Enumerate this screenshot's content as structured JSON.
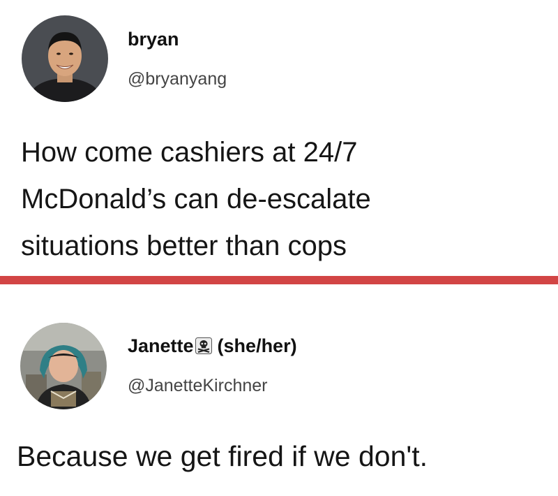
{
  "tweet_1": {
    "display_name": "bryan",
    "handle": "@bryanyang",
    "text_lines": [
      "How come cashiers at 24/7",
      "McDonald’s can de-escalate",
      "situations better than cops"
    ]
  },
  "tweet_2": {
    "display_name": "Janette",
    "badge_icon": "skull-crossbones-icon",
    "pronouns": "(she/her)",
    "handle": "@JanetteKirchner",
    "text": "Because we get fired if we don't."
  },
  "colors": {
    "divider": "#d24545",
    "background": "#ffffff",
    "text": "#151515",
    "handle": "#444444"
  }
}
